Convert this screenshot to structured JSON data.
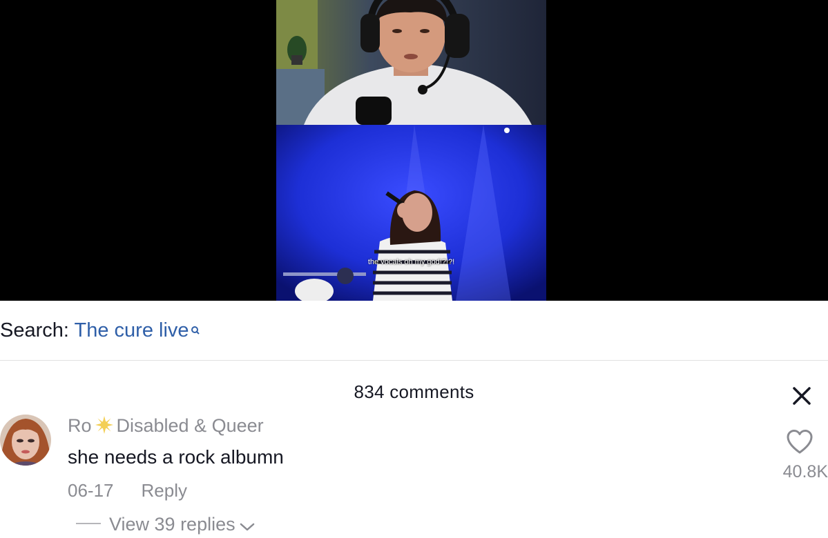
{
  "video": {
    "caption": "the vocals oh my god!?!?!"
  },
  "search": {
    "label": "Search:",
    "term": "The cure live"
  },
  "comments": {
    "count_label": "834 comments",
    "items": [
      {
        "username": "Ro",
        "tag": "Disabled & Queer",
        "text": "she needs a rock albumn",
        "date": "06-17",
        "reply_label": "Reply",
        "view_replies_label": "View 39 replies",
        "like_count": "40.8K"
      }
    ]
  },
  "colors": {
    "search_link": "#2f5fa8",
    "muted_text": "#8a8b91",
    "primary_text": "#161823",
    "stage_blue": "#1d2fd6"
  },
  "icons": {
    "close": "close-icon",
    "like": "heart-outline-icon",
    "search": "search-icon",
    "chevron": "chevron-down-icon",
    "badge": "sun-icon"
  }
}
